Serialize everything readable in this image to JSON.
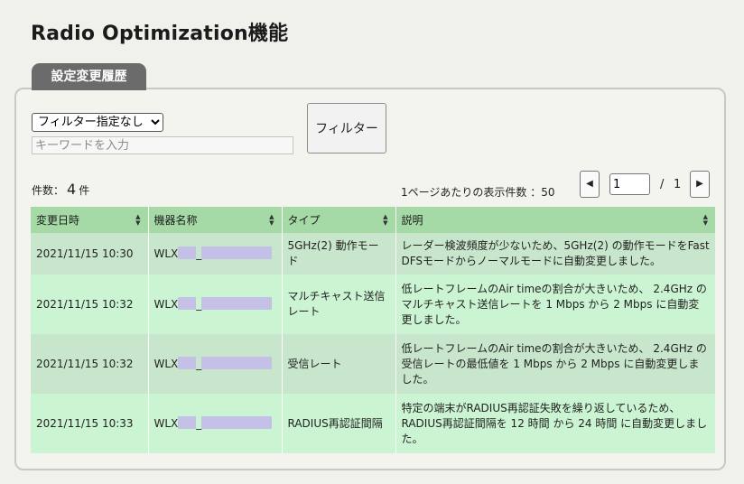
{
  "page": {
    "title": "Radio Optimization機能"
  },
  "tab": {
    "label": "設定変更履歴"
  },
  "filter": {
    "select_value": "フィルター指定なし",
    "keyword_placeholder": "キーワードを入力",
    "button_label": "フィルター"
  },
  "summary": {
    "count_label": "件数：",
    "count_value": "4",
    "count_unit": "件",
    "per_page_label": "1ページあたりの表示件数 ：50"
  },
  "pager": {
    "prev_icon": "◀",
    "next_icon": "▶",
    "current_page": "1",
    "separator": "/",
    "total_pages": "1"
  },
  "table": {
    "headers": [
      "変更日時",
      "機器名称",
      "タイプ",
      "説明"
    ],
    "rows": [
      {
        "datetime": "2021/11/15 10:30",
        "device_prefix": "WLX",
        "device_sep": "_",
        "type": "5GHz(2) 動作モード",
        "description": "レーダー検波頻度が少ないため、5GHz(2) の動作モードをFast DFSモードからノーマルモードに自動変更しました。"
      },
      {
        "datetime": "2021/11/15 10:32",
        "device_prefix": "WLX",
        "device_sep": "_",
        "type": "マルチキャスト送信レート",
        "description": "低レートフレームのAir timeの割合が大きいため、 2.4GHz のマルチキャスト送信レートを 1 Mbps から 2 Mbps に自動変更しました。"
      },
      {
        "datetime": "2021/11/15 10:32",
        "device_prefix": "WLX",
        "device_sep": "_",
        "type": "受信レート",
        "description": "低レートフレームのAir timeの割合が大きいため、 2.4GHz の受信レートの最低値を 1 Mbps から 2 Mbps に自動変更しました。"
      },
      {
        "datetime": "2021/11/15 10:33",
        "device_prefix": "WLX",
        "device_sep": "_",
        "type": "RADIUS再認証間隔",
        "description": "特定の端末がRADIUS再認証失敗を繰り返しているため、RADIUS再認証間隔を 12 時間 から 24 時間 に自動変更しました。"
      }
    ]
  },
  "colors": {
    "header_bg": "#a5d9a5",
    "row_odd_bg": "#c8e6cc",
    "row_even_bg": "#cbf4d2",
    "redaction": "#c5c0e7",
    "tab_bg": "#6b6b6b"
  },
  "icons": {
    "sort": "sort-icon",
    "pager_prev": "triangle-left-icon",
    "pager_next": "triangle-right-icon"
  }
}
